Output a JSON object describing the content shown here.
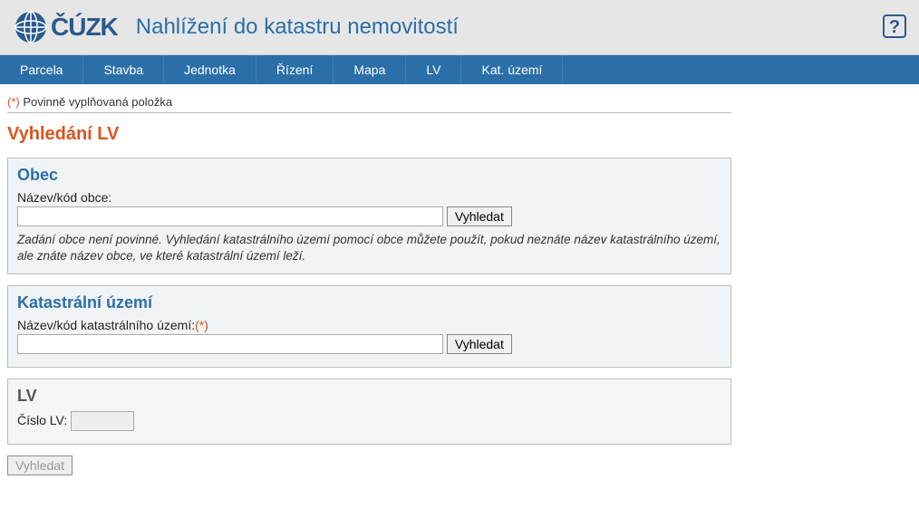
{
  "header": {
    "logo_text": "ČÚZK",
    "title": "Nahlížení do katastru nemovitostí",
    "help_label": "?"
  },
  "nav": {
    "items": [
      "Parcela",
      "Stavba",
      "Jednotka",
      "Řízení",
      "Mapa",
      "LV",
      "Kat. území"
    ]
  },
  "mandatory_prefix": "(*)",
  "mandatory_text": " Povinně vyplňovaná položka",
  "page_title": "Vyhledání LV",
  "panel_obec": {
    "title": "Obec",
    "label": "Název/kód obce:",
    "button": "Vyhledat",
    "hint": "Zadání obce není povinné. Vyhledání katastrálního území pomocí obce můžete použít, pokud neznáte název katastrálního území, ale znáte název obce, ve které katastrální území leží."
  },
  "panel_ku": {
    "title": "Katastrální území",
    "label": "Název/kód katastrálního území:",
    "req": "(*)",
    "button": "Vyhledat"
  },
  "panel_lv": {
    "title": "LV",
    "label": "Číslo LV:"
  },
  "submit_button": "Vyhledat"
}
